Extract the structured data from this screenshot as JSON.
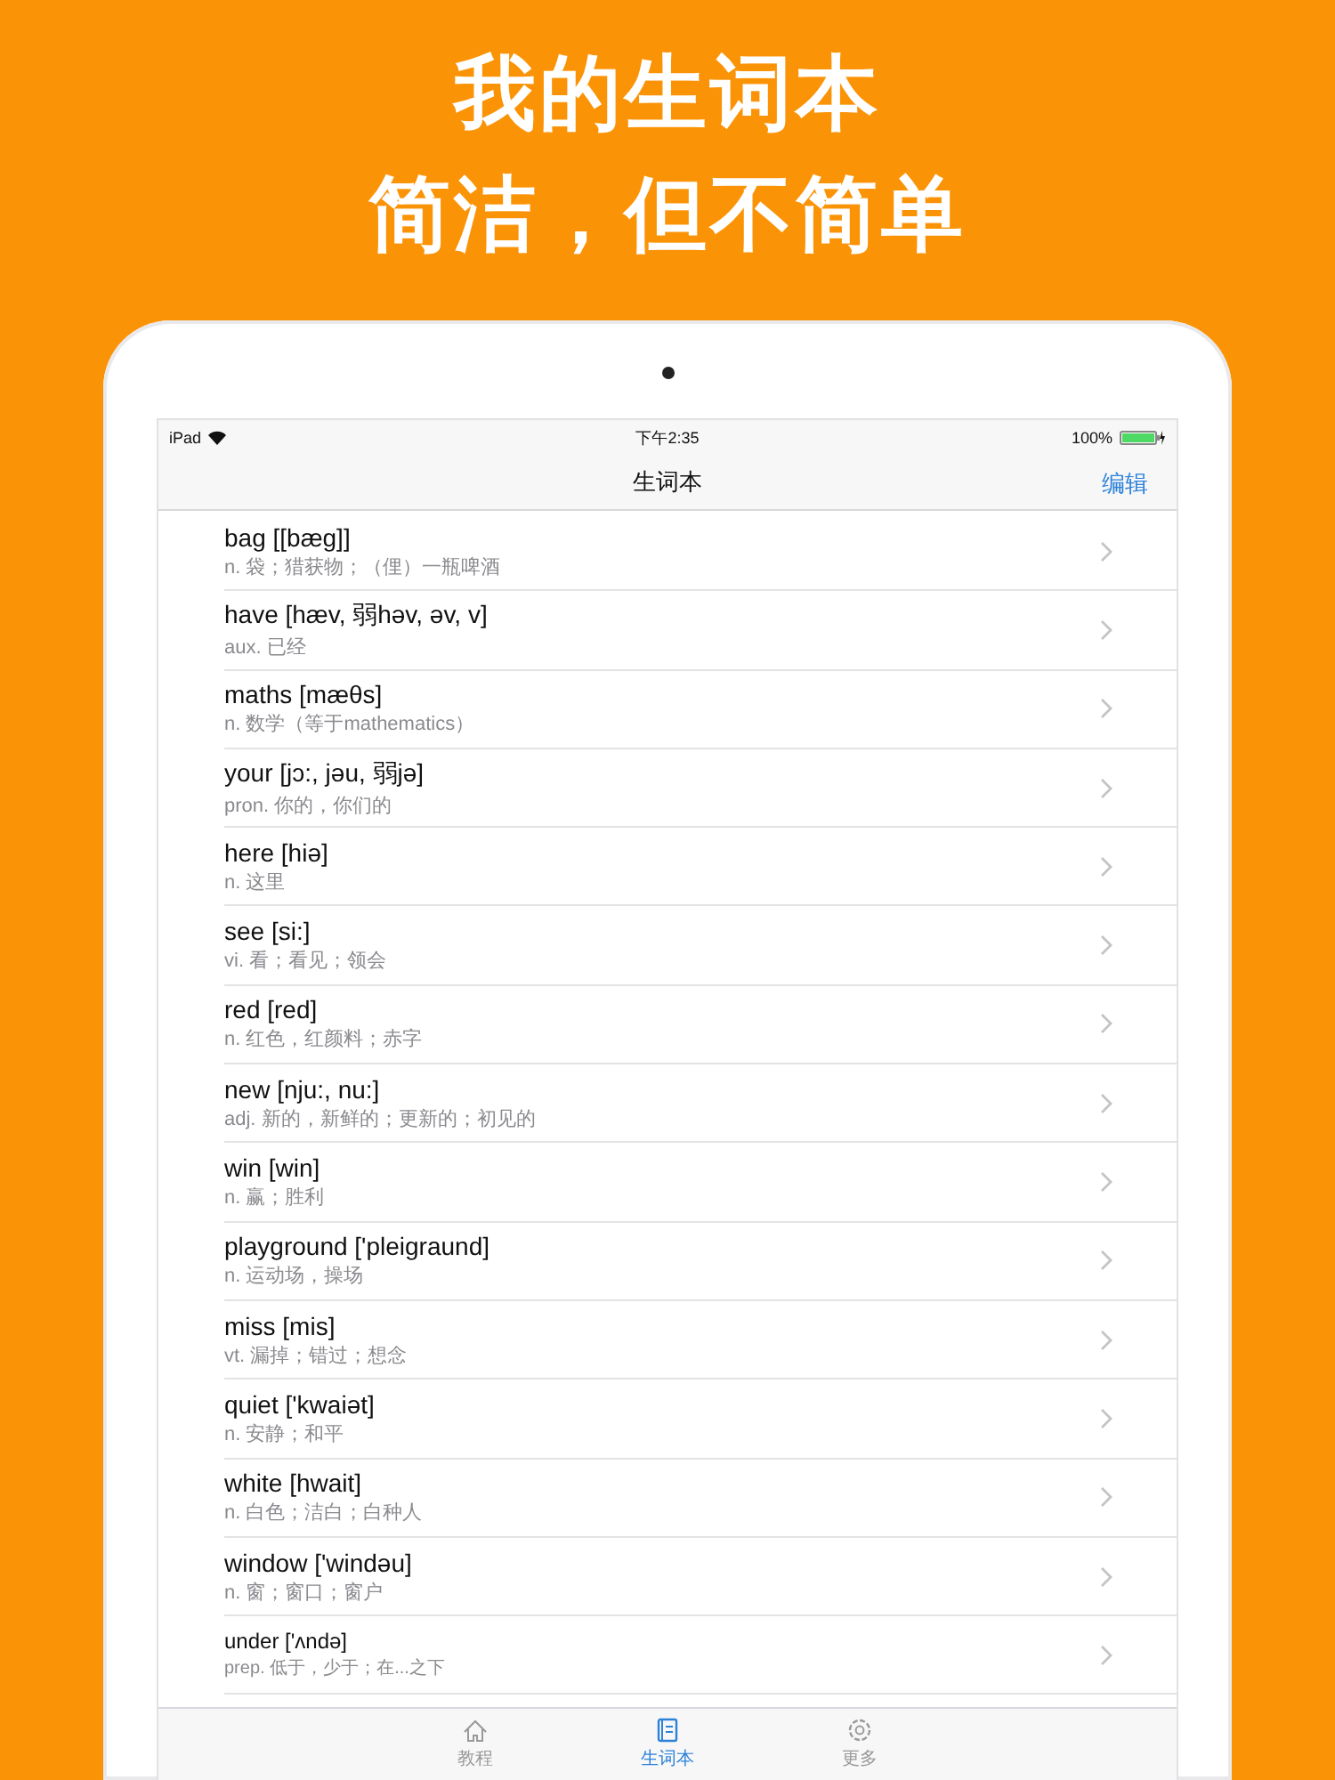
{
  "headline": [
    "我的生词本",
    "简洁，但不简单"
  ],
  "status_bar": {
    "device": "iPad",
    "time": "下午2:35",
    "battery": "100%"
  },
  "nav_bar": {
    "title": "生词本",
    "action": "编辑"
  },
  "words": [
    {
      "word": "bag [[bæg]]",
      "meaning": "n. 袋；猎获物；（俚）一瓶啤酒"
    },
    {
      "word": "have [hæv, 弱həv, əv, v]",
      "meaning": "aux. 已经"
    },
    {
      "word": "maths [mæθs]",
      "meaning": "n. 数学（等于mathematics）"
    },
    {
      "word": "your [jɔ:, jəu, 弱jə]",
      "meaning": "pron. 你的，你们的"
    },
    {
      "word": "here [hiə]",
      "meaning": "n. 这里"
    },
    {
      "word": "see [si:]",
      "meaning": "vi. 看；看见；领会"
    },
    {
      "word": "red [red]",
      "meaning": "n. 红色，红颜料；赤字"
    },
    {
      "word": "new [nju:, nu:]",
      "meaning": "adj. 新的，新鲜的；更新的；初见的"
    },
    {
      "word": "win [win]",
      "meaning": "n. 赢；胜利"
    },
    {
      "word": "playground ['pleigraund]",
      "meaning": "n. 运动场，操场"
    },
    {
      "word": "miss [mis]",
      "meaning": "vt. 漏掉；错过；想念"
    },
    {
      "word": "quiet ['kwaiət]",
      "meaning": "n. 安静；和平"
    },
    {
      "word": "white [hwait]",
      "meaning": "n. 白色；洁白；白种人"
    },
    {
      "word": "window ['windəu]",
      "meaning": "n. 窗；窗口；窗户"
    },
    {
      "word": "under ['ʌndə]",
      "meaning": "prep. 低于，少于；在...之下",
      "kind": "small"
    }
  ],
  "tabs": [
    {
      "label": "教程",
      "kind": "home",
      "selected": false
    },
    {
      "label": "生词本",
      "kind": "book",
      "selected": true
    },
    {
      "label": "更多",
      "kind": "gear",
      "selected": false
    }
  ]
}
